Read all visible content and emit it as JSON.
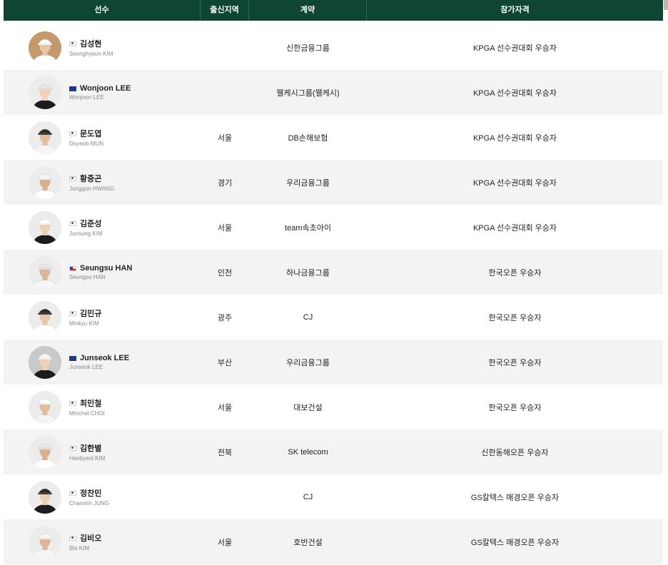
{
  "header": {
    "col_player": "선수",
    "col_region": "출신지역",
    "col_contract": "계약",
    "col_qualification": "참가자격"
  },
  "colors": {
    "header_bg": "#0e4632",
    "row_alt_bg": "#f3f3f3"
  },
  "rows": [
    {
      "flag": "kr",
      "name": "김성현",
      "eng": "Seonghyeon KIM",
      "region": "",
      "contract": "신한금융그룹",
      "qualification": "KPGA 선수권대회 우승자"
    },
    {
      "flag": "au",
      "name": "Wonjoon LEE",
      "eng": "Wonjoon LEE",
      "region": "",
      "contract": "웰케시그룹(웰케시)",
      "qualification": "KPGA 선수권대회 우승자"
    },
    {
      "flag": "kr",
      "name": "문도엽",
      "eng": "Doyeob MUN",
      "region": "서울",
      "contract": "DB손해보험",
      "qualification": "KPGA 선수권대회 우승자"
    },
    {
      "flag": "kr",
      "name": "황중곤",
      "eng": "Junggon HWANG",
      "region": "경기",
      "contract": "우리금융그룹",
      "qualification": "KPGA 선수권대회 우승자"
    },
    {
      "flag": "kr",
      "name": "김준성",
      "eng": "Junsung KIM",
      "region": "서울",
      "contract": "team속초아이",
      "qualification": "KPGA 선수권대회 우승자"
    },
    {
      "flag": "cl",
      "name": "Seungsu HAN",
      "eng": "Seungsu HAN",
      "region": "인천",
      "contract": "하나금융그룹",
      "qualification": "한국오픈 우승자"
    },
    {
      "flag": "kr",
      "name": "김민규",
      "eng": "Minkyu KIM",
      "region": "광주",
      "contract": "CJ",
      "qualification": "한국오픈 우승자"
    },
    {
      "flag": "au",
      "name": "Junseok LEE",
      "eng": "Junseok LEE",
      "region": "부산",
      "contract": "우리금융그룹",
      "qualification": "한국오픈 우승자"
    },
    {
      "flag": "kr",
      "name": "최민철",
      "eng": "Minchel CHOI",
      "region": "서울",
      "contract": "대보건설",
      "qualification": "한국오픈 우승자"
    },
    {
      "flag": "kr",
      "name": "김한별",
      "eng": "Hanbyeol KIM",
      "region": "전북",
      "contract": "SK telecom",
      "qualification": "신한동해오픈 우승자"
    },
    {
      "flag": "kr",
      "name": "정찬민",
      "eng": "Chanmin JUNG",
      "region": "",
      "contract": "CJ",
      "qualification": "GS칼텍스 매경오픈 우승자"
    },
    {
      "flag": "kr",
      "name": "김비오",
      "eng": "Bio KIM",
      "region": "서울",
      "contract": "호반건설",
      "qualification": "GS칼텍스 매경오픈 우승자"
    }
  ]
}
